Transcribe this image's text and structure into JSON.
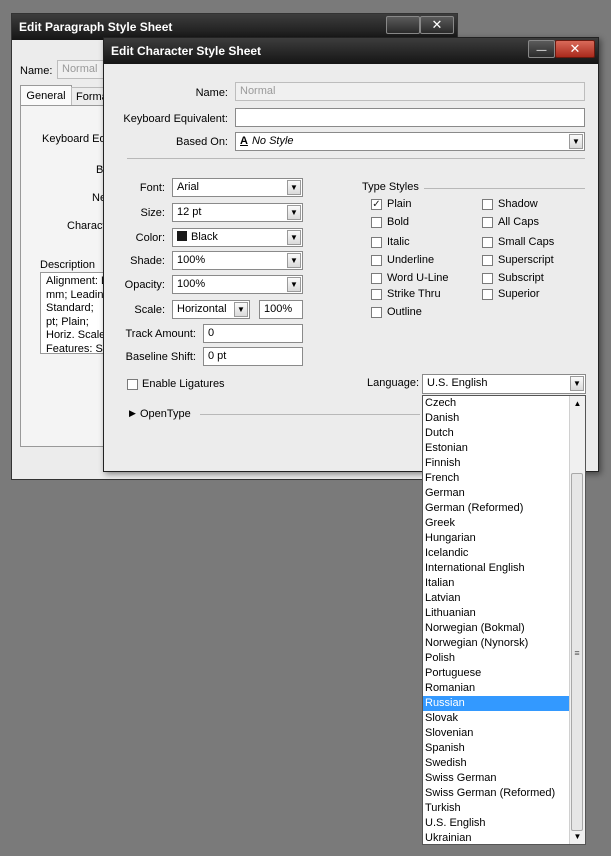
{
  "paragraph_dialog": {
    "title": "Edit Paragraph Style Sheet",
    "name_label": "Name:",
    "name_value": "Normal",
    "tabs": [
      {
        "label": "General"
      },
      {
        "label": "Forma"
      }
    ],
    "keyboard_equiv_label": "Keyboard Equ",
    "based_on_label": "Ba",
    "next_label": "Ne",
    "character_label": "Characte",
    "description_label": "Description",
    "description_lines": [
      "Alignment: L",
      "mm;  Leadin",
      "Standard;",
      "pt;  Plain;",
      "Horiz. Scale",
      "Features: S"
    ]
  },
  "character_dialog": {
    "title": "Edit Character Style Sheet",
    "name_label": "Name:",
    "name_value": "Normal",
    "keyboard_label": "Keyboard Equivalent:",
    "keyboard_value": "",
    "based_on_label": "Based On:",
    "based_on_icon": "character-style-icon",
    "based_on_value": "No Style",
    "font_label": "Font:",
    "font_value": "Arial",
    "size_label": "Size:",
    "size_value": "12 pt",
    "color_label": "Color:",
    "color_value": "Black",
    "shade_label": "Shade:",
    "shade_value": "100%",
    "opacity_label": "Opacity:",
    "opacity_value": "100%",
    "scale_label": "Scale:",
    "scale_mode": "Horizontal",
    "scale_value": "100%",
    "track_label": "Track Amount:",
    "track_value": "0",
    "baseline_label": "Baseline Shift:",
    "baseline_value": "0 pt",
    "ligatures_label": "Enable Ligatures",
    "opentype_label": "OpenType",
    "type_styles_label": "Type Styles",
    "type_styles_left": [
      {
        "label": "Plain",
        "checked": true
      },
      {
        "label": "Bold",
        "checked": false
      },
      {
        "label": "Italic",
        "checked": false
      },
      {
        "label": "Underline",
        "checked": false
      },
      {
        "label": "Word U-Line",
        "checked": false
      },
      {
        "label": "Strike Thru",
        "checked": false
      },
      {
        "label": "Outline",
        "checked": false
      }
    ],
    "type_styles_right": [
      {
        "label": "Shadow",
        "checked": false
      },
      {
        "label": "All Caps",
        "checked": false
      },
      {
        "label": "Small Caps",
        "checked": false
      },
      {
        "label": "Superscript",
        "checked": false
      },
      {
        "label": "Subscript",
        "checked": false
      },
      {
        "label": "Superior",
        "checked": false
      }
    ],
    "language_label": "Language:",
    "language_value": "U.S. English",
    "language_options": [
      "Czech",
      "Danish",
      "Dutch",
      "Estonian",
      "Finnish",
      "French",
      "German",
      "German (Reformed)",
      "Greek",
      "Hungarian",
      "Icelandic",
      "International English",
      "Italian",
      "Latvian",
      "Lithuanian",
      "Norwegian (Bokmal)",
      "Norwegian (Nynorsk)",
      "Polish",
      "Portuguese",
      "Romanian",
      "Russian",
      "Slovak",
      "Slovenian",
      "Spanish",
      "Swedish",
      "Swiss German",
      "Swiss German (Reformed)",
      "Turkish",
      "U.S. English",
      "Ukrainian"
    ],
    "highlighted_option": "Russian"
  },
  "icons": {
    "close": "✕",
    "minimize": "—",
    "dropdown": "▼",
    "disclosure": "▶",
    "scroll_up": "▲",
    "scroll_down": "▼",
    "grip": "≡",
    "check": "✓"
  }
}
